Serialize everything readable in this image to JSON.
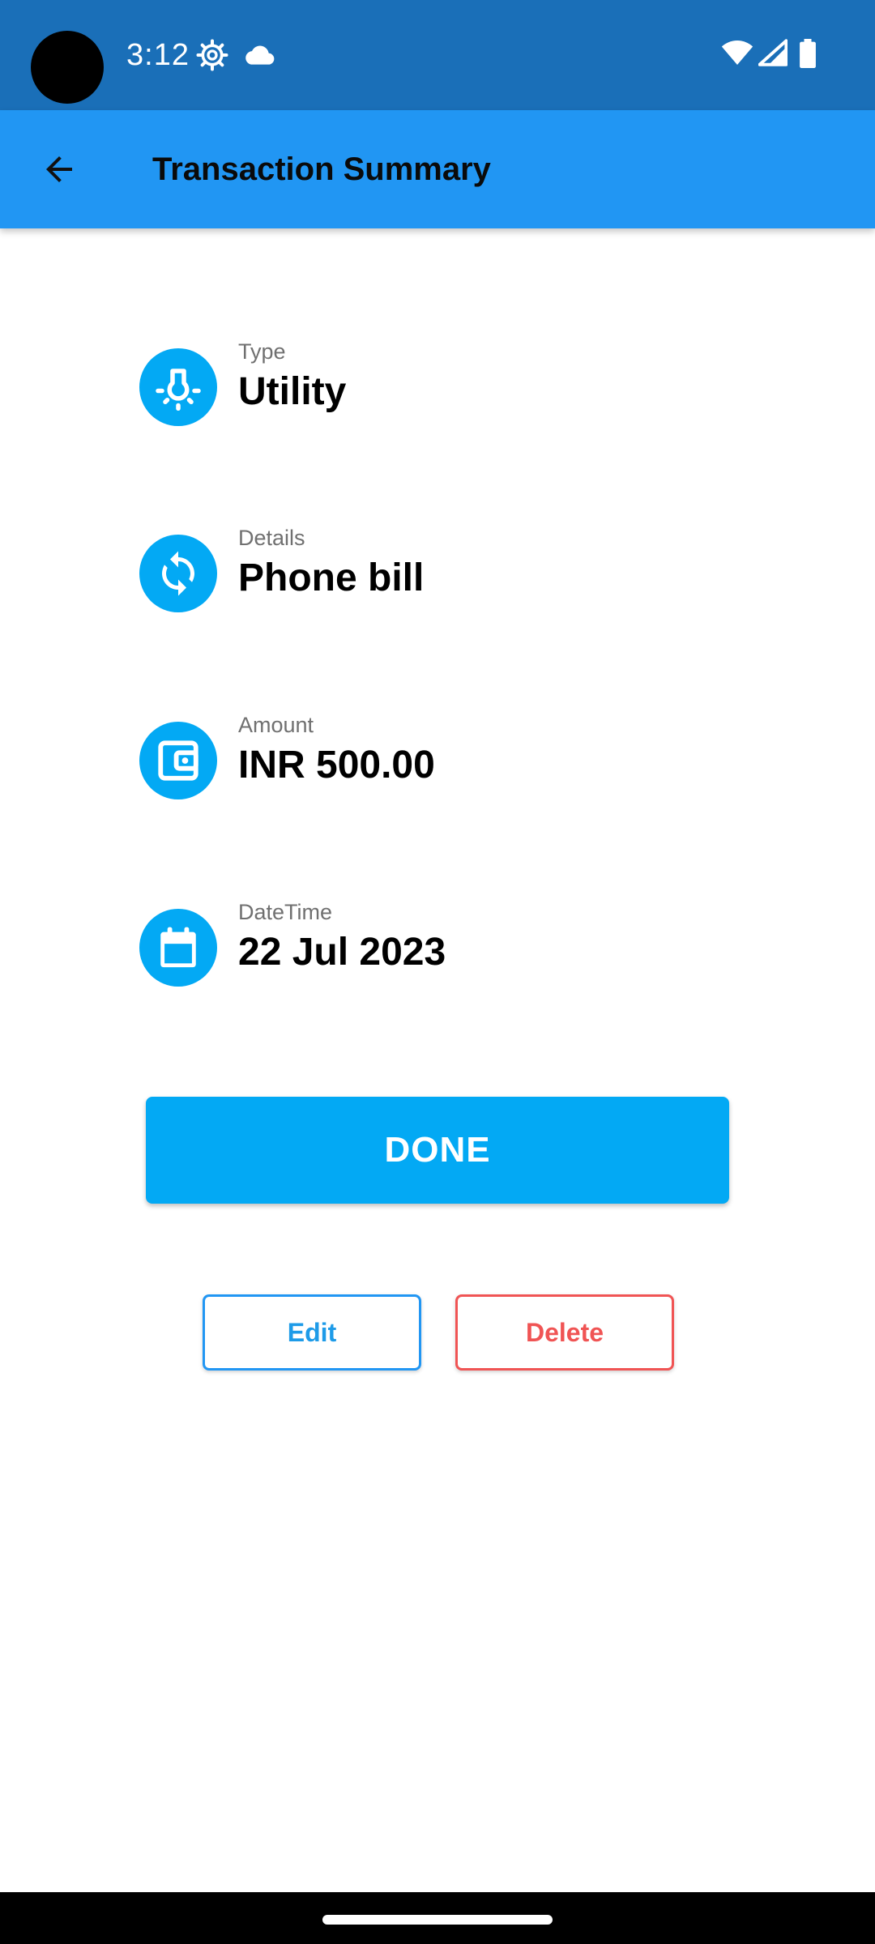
{
  "status_bar": {
    "time": "3:12",
    "icons": [
      "settings-gear-icon",
      "cloud-icon",
      "wifi-icon",
      "cell-signal-icon",
      "battery-icon"
    ]
  },
  "app_bar": {
    "title": "Transaction Summary",
    "back_icon": "arrow-back-icon",
    "background_color": "#2196f3"
  },
  "summary": {
    "type": {
      "label": "Type",
      "value": "Utility",
      "icon": "lightbulb-icon"
    },
    "details": {
      "label": "Details",
      "value": "Phone bill",
      "icon": "sync-icon"
    },
    "amount": {
      "label": "Amount",
      "value": "INR 500.00",
      "icon": "wallet-icon"
    },
    "datetime": {
      "label": "DateTime",
      "value": "22 Jul 2023",
      "icon": "calendar-icon"
    }
  },
  "actions": {
    "done_label": "DONE",
    "edit_label": "Edit",
    "delete_label": "Delete"
  },
  "colors": {
    "accent": "#03a9f4",
    "status_bar": "#1a6fb8",
    "delete": "#f05454"
  }
}
